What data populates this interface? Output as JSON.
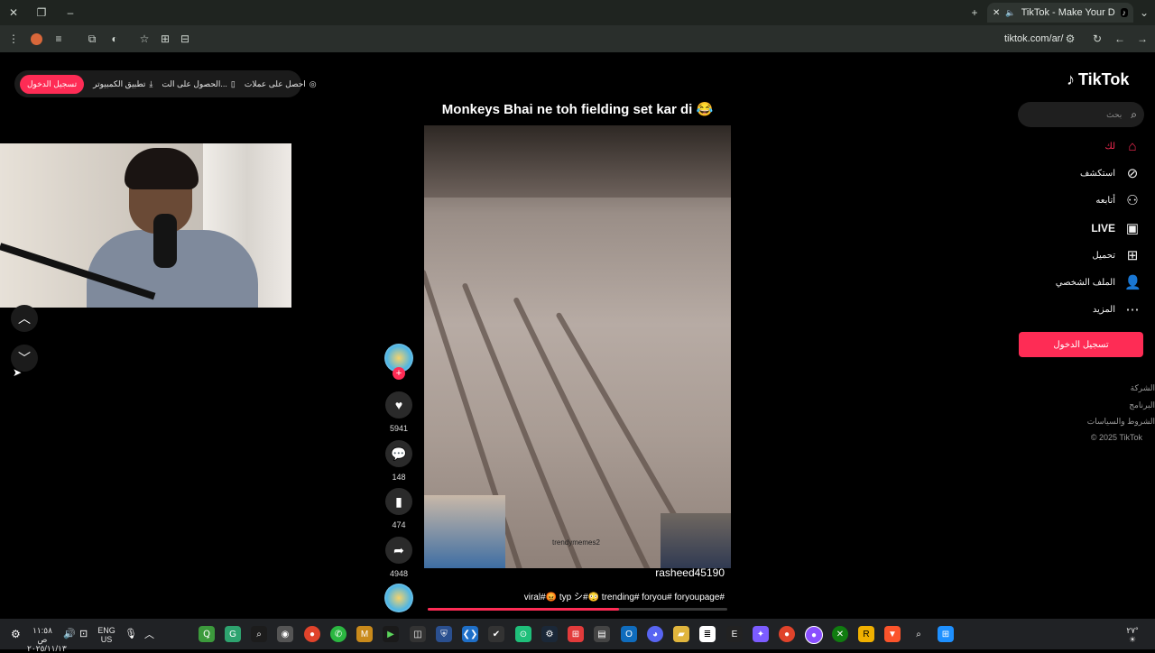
{
  "browser": {
    "tab_title": "TikTok - Make Your Day",
    "url": "tiktok.com/ar/"
  },
  "top_actions": {
    "login": "تسجيل الدخول",
    "desktop_app": "تطبيق الكمبيوتر",
    "get_app": "الحصول على الت...",
    "get_coins": "احصل على عملات"
  },
  "video": {
    "title": "Monkeys Bhai ne toh fielding set kar di 😂",
    "watermark": "trendymemes2",
    "username": "rasheed45190",
    "hashtags": "viral#😡 typ シ#😳 trending# foryou# foryoupage#",
    "progress": 0.64
  },
  "rail": {
    "likes": "5941",
    "comments": "148",
    "saves": "474",
    "shares": "4948"
  },
  "sidebar": {
    "logo": "TikTok",
    "search_placeholder": "بحث",
    "items": [
      {
        "label": "لك",
        "icon": "home-icon"
      },
      {
        "label": "استكشف",
        "icon": "compass-icon"
      },
      {
        "label": "أتابعه",
        "icon": "following-icon"
      },
      {
        "label": "LIVE",
        "icon": "live-icon"
      },
      {
        "label": "تحميل",
        "icon": "upload-icon"
      },
      {
        "label": "الملف الشخصي",
        "icon": "profile-icon"
      },
      {
        "label": "المزيد",
        "icon": "more-icon"
      }
    ],
    "login_button": "تسجيل الدخول",
    "footer": [
      "الشركة",
      "البرنامج",
      "الشروط والسياسات",
      "© 2025 TikTok"
    ]
  },
  "taskbar": {
    "lang_top": "ENG",
    "lang_bottom": "US",
    "time": "١١:٥٨ ص",
    "date": "٢٠٢٥/١١/١٣",
    "corner": "٢٧°"
  },
  "colors": {
    "accent": "#fe2c55",
    "background": "#000000"
  }
}
